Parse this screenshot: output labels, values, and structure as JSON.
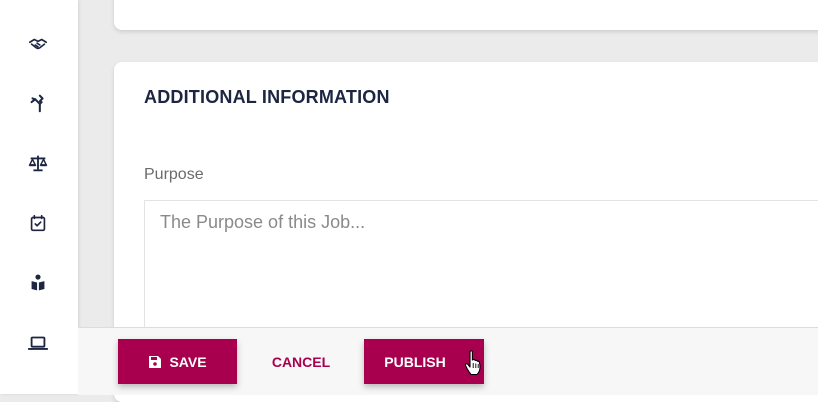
{
  "sidebar": {
    "icons": [
      {
        "name": "handshake-icon"
      },
      {
        "name": "split-arrows-icon"
      },
      {
        "name": "scales-icon"
      },
      {
        "name": "calendar-check-icon"
      },
      {
        "name": "reader-icon"
      },
      {
        "name": "laptop-icon"
      }
    ]
  },
  "section": {
    "title": "ADDITIONAL INFORMATION"
  },
  "purpose": {
    "label": "Purpose",
    "placeholder": "The Purpose of this Job...",
    "value": ""
  },
  "footer": {
    "save_label": "SAVE",
    "cancel_label": "CANCEL",
    "publish_label": "PUBLISH"
  },
  "colors": {
    "accent": "#a8004f",
    "title": "#1c2541",
    "sidebar_icon": "#1c2541"
  }
}
